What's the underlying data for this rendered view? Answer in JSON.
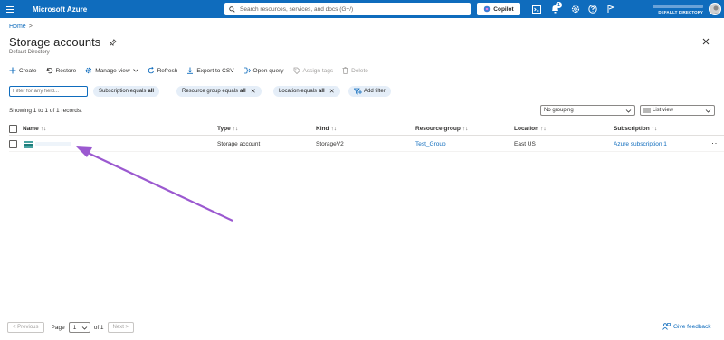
{
  "app": {
    "title": "Microsoft Azure"
  },
  "search": {
    "placeholder": "Search resources, services, and docs (G+/)"
  },
  "copilot": {
    "label": "Copilot"
  },
  "notifications": {
    "count": "1"
  },
  "account": {
    "directory": "DEFAULT DIRECTORY"
  },
  "breadcrumb": {
    "home": "Home",
    "separator": ">"
  },
  "page": {
    "title": "Storage accounts",
    "subtitle": "Default Directory"
  },
  "toolbar": {
    "create": "Create",
    "restore": "Restore",
    "manage_view": "Manage view",
    "refresh": "Refresh",
    "export_csv": "Export to CSV",
    "open_query": "Open query",
    "assign_tags": "Assign tags",
    "delete": "Delete"
  },
  "filters": {
    "input_placeholder": "Filter for any field...",
    "subscription": {
      "label": "Subscription equals",
      "value": "all"
    },
    "resource_group": {
      "label": "Resource group equals",
      "value": "all"
    },
    "location": {
      "label": "Location equals",
      "value": "all"
    },
    "add_filter": "Add filter"
  },
  "records": {
    "text": "Showing 1 to 1 of 1 records."
  },
  "grouping": {
    "selected": "No grouping"
  },
  "view": {
    "selected": "List view"
  },
  "table": {
    "columns": [
      "Name",
      "Type",
      "Kind",
      "Resource group",
      "Location",
      "Subscription"
    ],
    "rows": [
      {
        "name": "",
        "type": "Storage account",
        "kind": "StorageV2",
        "resource_group": "Test_Group",
        "location": "East US",
        "subscription": "Azure subscription 1"
      }
    ]
  },
  "pagination": {
    "previous": "< Previous",
    "page_label": "Page",
    "page": "1",
    "of": "of 1",
    "next": "Next >"
  },
  "feedback": {
    "label": "Give feedback"
  },
  "colors": {
    "brand": "#0f6cbd",
    "annotation_arrow": "#9b59d0"
  }
}
